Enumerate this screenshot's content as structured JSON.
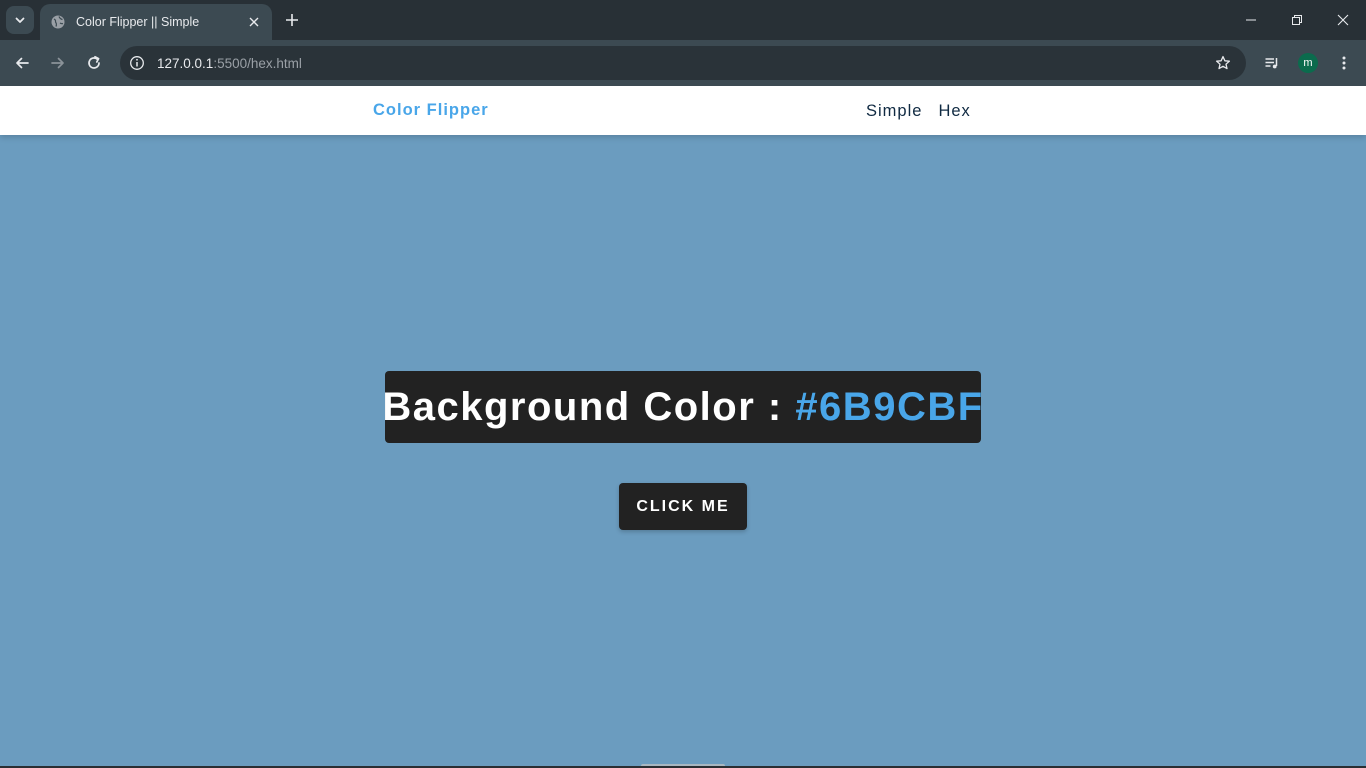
{
  "browser": {
    "tab_title": "Color Flipper || Simple",
    "url_host": "127.0.0.1",
    "url_rest": ":5500/hex.html",
    "profile_initial": "m"
  },
  "page": {
    "brand": "Color Flipper",
    "nav_links": [
      "Simple",
      "Hex"
    ],
    "heading_label": "Background Color : ",
    "color_value": "#6B9CBF",
    "button_label": "CLICK ME"
  },
  "colors": {
    "background": "#6B9CBF",
    "accent": "#49A6E9",
    "dark": "#222222"
  },
  "icons": [
    "tab-search-icon",
    "globe-icon",
    "close-icon",
    "plus-icon",
    "minimize-icon",
    "restore-icon",
    "back-arrow-icon",
    "forward-arrow-icon",
    "reload-icon",
    "info-icon",
    "star-icon",
    "media-queue-icon",
    "menu-dots-icon"
  ]
}
